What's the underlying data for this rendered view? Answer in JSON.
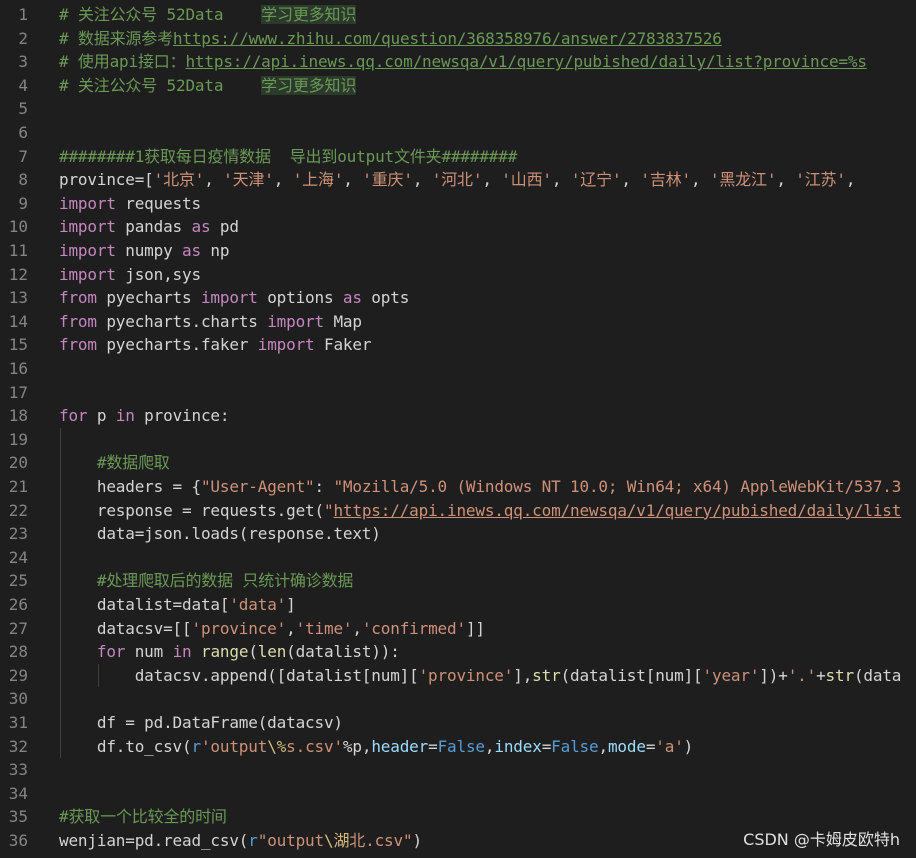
{
  "colors": {
    "background": "#1e1e1e",
    "line_number": "#858585",
    "comment": "#6a9955",
    "keyword": "#569cd6",
    "control": "#c586c0",
    "string": "#ce9178",
    "function": "#dcdcaa",
    "variable": "#9cdcfe"
  },
  "lines": [
    {
      "n": "1",
      "tokens": [
        [
          "comment",
          "# 关注公众号 52Data    "
        ],
        [
          "comment hl",
          "学习更多知识"
        ]
      ]
    },
    {
      "n": "2",
      "tokens": [
        [
          "comment",
          "# 数据来源参考"
        ],
        [
          "comment url",
          "https://www.zhihu.com/question/368358976/answer/2783837526"
        ]
      ]
    },
    {
      "n": "3",
      "tokens": [
        [
          "comment",
          "# 使用api接口："
        ],
        [
          "comment url",
          "https://api.inews.qq.com/newsqa/v1/query/pubished/daily/list?province=%s"
        ]
      ]
    },
    {
      "n": "4",
      "tokens": [
        [
          "comment",
          "# 关注公众号 52Data    "
        ],
        [
          "comment hl",
          "学习更多知识"
        ]
      ]
    },
    {
      "n": "5",
      "tokens": []
    },
    {
      "n": "6",
      "tokens": []
    },
    {
      "n": "7",
      "tokens": [
        [
          "comment",
          "########1获取每日疫情数据  导出到output文件夹########"
        ]
      ]
    },
    {
      "n": "8",
      "tokens": [
        [
          "plain",
          "province=["
        ],
        [
          "str",
          "'北京'"
        ],
        [
          "plain",
          ", "
        ],
        [
          "str",
          "'天津'"
        ],
        [
          "plain",
          ", "
        ],
        [
          "str",
          "'上海'"
        ],
        [
          "plain",
          ", "
        ],
        [
          "str",
          "'重庆'"
        ],
        [
          "plain",
          ", "
        ],
        [
          "str",
          "'河北'"
        ],
        [
          "plain",
          ", "
        ],
        [
          "str",
          "'山西'"
        ],
        [
          "plain",
          ", "
        ],
        [
          "str",
          "'辽宁'"
        ],
        [
          "plain",
          ", "
        ],
        [
          "str",
          "'吉林'"
        ],
        [
          "plain",
          ", "
        ],
        [
          "str",
          "'黑龙江'"
        ],
        [
          "plain",
          ", "
        ],
        [
          "str",
          "'江苏'"
        ],
        [
          "plain",
          ","
        ]
      ]
    },
    {
      "n": "9",
      "tokens": [
        [
          "ctrl",
          "import"
        ],
        [
          "plain",
          " requests"
        ]
      ]
    },
    {
      "n": "10",
      "tokens": [
        [
          "ctrl",
          "import"
        ],
        [
          "plain",
          " pandas "
        ],
        [
          "ctrl",
          "as"
        ],
        [
          "plain",
          " pd"
        ]
      ]
    },
    {
      "n": "11",
      "tokens": [
        [
          "ctrl",
          "import"
        ],
        [
          "plain",
          " numpy "
        ],
        [
          "ctrl",
          "as"
        ],
        [
          "plain",
          " np"
        ]
      ]
    },
    {
      "n": "12",
      "tokens": [
        [
          "ctrl",
          "import"
        ],
        [
          "plain",
          " json,sys"
        ]
      ]
    },
    {
      "n": "13",
      "tokens": [
        [
          "ctrl",
          "from"
        ],
        [
          "plain",
          " pyecharts "
        ],
        [
          "ctrl",
          "import"
        ],
        [
          "plain",
          " options "
        ],
        [
          "ctrl",
          "as"
        ],
        [
          "plain",
          " opts"
        ]
      ]
    },
    {
      "n": "14",
      "tokens": [
        [
          "ctrl",
          "from"
        ],
        [
          "plain",
          " pyecharts.charts "
        ],
        [
          "ctrl",
          "import"
        ],
        [
          "plain",
          " Map"
        ]
      ]
    },
    {
      "n": "15",
      "tokens": [
        [
          "ctrl",
          "from"
        ],
        [
          "plain",
          " pyecharts.faker "
        ],
        [
          "ctrl",
          "import"
        ],
        [
          "plain",
          " Faker"
        ]
      ]
    },
    {
      "n": "16",
      "tokens": []
    },
    {
      "n": "17",
      "tokens": []
    },
    {
      "n": "18",
      "tokens": [
        [
          "ctrl",
          "for"
        ],
        [
          "plain",
          " p "
        ],
        [
          "ctrl",
          "in"
        ],
        [
          "plain",
          " province:"
        ]
      ]
    },
    {
      "n": "19",
      "tokens": []
    },
    {
      "n": "20",
      "tokens": [
        [
          "plain",
          "    "
        ],
        [
          "comment",
          "#数据爬取"
        ]
      ]
    },
    {
      "n": "21",
      "tokens": [
        [
          "plain",
          "    headers = {"
        ],
        [
          "str",
          "\"User-Agent\""
        ],
        [
          "plain",
          ": "
        ],
        [
          "str",
          "\"Mozilla/5.0 (Windows NT 10.0; Win64; x64) AppleWebKit/537.3"
        ]
      ]
    },
    {
      "n": "22",
      "tokens": [
        [
          "plain",
          "    response = requests.get("
        ],
        [
          "str",
          "\""
        ],
        [
          "str url",
          "https://api.inews.qq.com/newsqa/v1/query/pubished/daily/list"
        ]
      ]
    },
    {
      "n": "23",
      "tokens": [
        [
          "plain",
          "    data=json.loads(response.text)"
        ]
      ]
    },
    {
      "n": "24",
      "tokens": []
    },
    {
      "n": "25",
      "tokens": [
        [
          "plain",
          "    "
        ],
        [
          "comment",
          "#处理爬取后的数据 只统计确诊数据"
        ]
      ]
    },
    {
      "n": "26",
      "tokens": [
        [
          "plain",
          "    datalist=data["
        ],
        [
          "str",
          "'data'"
        ],
        [
          "plain",
          "]"
        ]
      ]
    },
    {
      "n": "27",
      "tokens": [
        [
          "plain",
          "    datacsv=[["
        ],
        [
          "str",
          "'province'"
        ],
        [
          "plain",
          ","
        ],
        [
          "str",
          "'time'"
        ],
        [
          "plain",
          ","
        ],
        [
          "str",
          "'confirmed'"
        ],
        [
          "plain",
          "]]"
        ]
      ]
    },
    {
      "n": "28",
      "tokens": [
        [
          "plain",
          "    "
        ],
        [
          "ctrl",
          "for"
        ],
        [
          "plain",
          " num "
        ],
        [
          "ctrl",
          "in"
        ],
        [
          "plain",
          " "
        ],
        [
          "func",
          "range"
        ],
        [
          "plain",
          "("
        ],
        [
          "func",
          "len"
        ],
        [
          "plain",
          "(datalist)):"
        ]
      ]
    },
    {
      "n": "29",
      "tokens": [
        [
          "plain",
          "        datacsv.append([datalist[num]["
        ],
        [
          "str",
          "'province'"
        ],
        [
          "plain",
          "],"
        ],
        [
          "func",
          "str"
        ],
        [
          "plain",
          "(datalist[num]["
        ],
        [
          "str",
          "'year'"
        ],
        [
          "plain",
          "])+"
        ],
        [
          "str",
          "'.'"
        ],
        [
          "plain",
          "+"
        ],
        [
          "func",
          "str"
        ],
        [
          "plain",
          "(data"
        ]
      ]
    },
    {
      "n": "30",
      "tokens": []
    },
    {
      "n": "31",
      "tokens": [
        [
          "plain",
          "    df = pd.DataFrame(datacsv)"
        ]
      ]
    },
    {
      "n": "32",
      "tokens": [
        [
          "plain",
          "    df.to_csv("
        ],
        [
          "kw",
          "r"
        ],
        [
          "str",
          "'output"
        ],
        [
          "esc",
          "\\%"
        ],
        [
          "str",
          "s.csv'"
        ],
        [
          "plain",
          "%p,"
        ],
        [
          "var",
          "header"
        ],
        [
          "plain",
          "="
        ],
        [
          "kw",
          "False"
        ],
        [
          "plain",
          ","
        ],
        [
          "var",
          "index"
        ],
        [
          "plain",
          "="
        ],
        [
          "kw",
          "False"
        ],
        [
          "plain",
          ","
        ],
        [
          "var",
          "mode"
        ],
        [
          "plain",
          "="
        ],
        [
          "str",
          "'a'"
        ],
        [
          "plain",
          ")"
        ]
      ]
    },
    {
      "n": "33",
      "tokens": []
    },
    {
      "n": "34",
      "tokens": []
    },
    {
      "n": "35",
      "tokens": [
        [
          "comment",
          "#获取一个比较全的时间"
        ]
      ]
    },
    {
      "n": "36",
      "tokens": [
        [
          "plain",
          "wenjian=pd.read_csv("
        ],
        [
          "kw",
          "r"
        ],
        [
          "str",
          "\"output"
        ],
        [
          "esc",
          "\\湖"
        ],
        [
          "str",
          "北.csv\""
        ],
        [
          "plain",
          ")"
        ]
      ]
    }
  ],
  "watermark": "CSDN @卡姆皮欧特h"
}
